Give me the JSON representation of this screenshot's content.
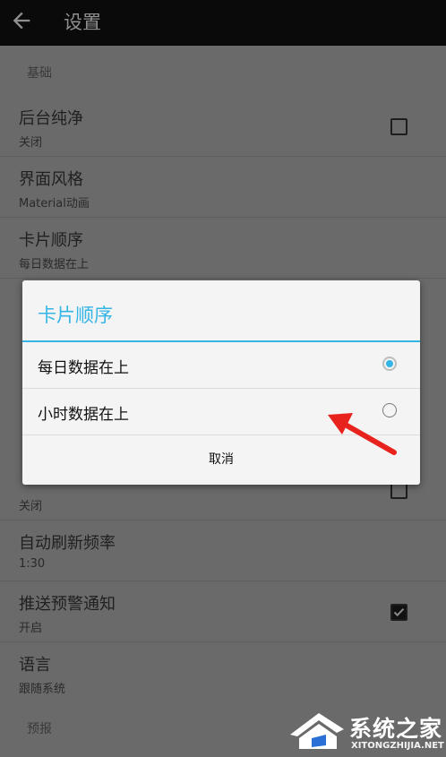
{
  "toolbar": {
    "title": "设置",
    "back_icon": "arrow-left-icon"
  },
  "sections": {
    "basic": "基础",
    "forecast": "预报"
  },
  "settings": [
    {
      "title": "后台纯净",
      "summary": "关闭",
      "checkbox": false
    },
    {
      "title": "界面风格",
      "summary": "Material动画"
    },
    {
      "title": "卡片顺序",
      "summary": "每日数据在上"
    },
    {
      "title": "",
      "summary": "关闭",
      "checkbox": false
    },
    {
      "title": "自动刷新频率",
      "summary": "1:30"
    },
    {
      "title": "推送预警通知",
      "summary": "开启",
      "checkbox": true
    },
    {
      "title": "语言",
      "summary": "跟随系统"
    }
  ],
  "dialog": {
    "title": "卡片顺序",
    "options": [
      {
        "label": "每日数据在上",
        "selected": true
      },
      {
        "label": "小时数据在上",
        "selected": false
      }
    ],
    "cancel_label": "取消",
    "accent_color": "#33b5e5"
  },
  "annotation": {
    "arrow_color": "#e8221c"
  },
  "watermark": {
    "name": "系统之家",
    "url": "XITONGZHIJIA.NET"
  }
}
